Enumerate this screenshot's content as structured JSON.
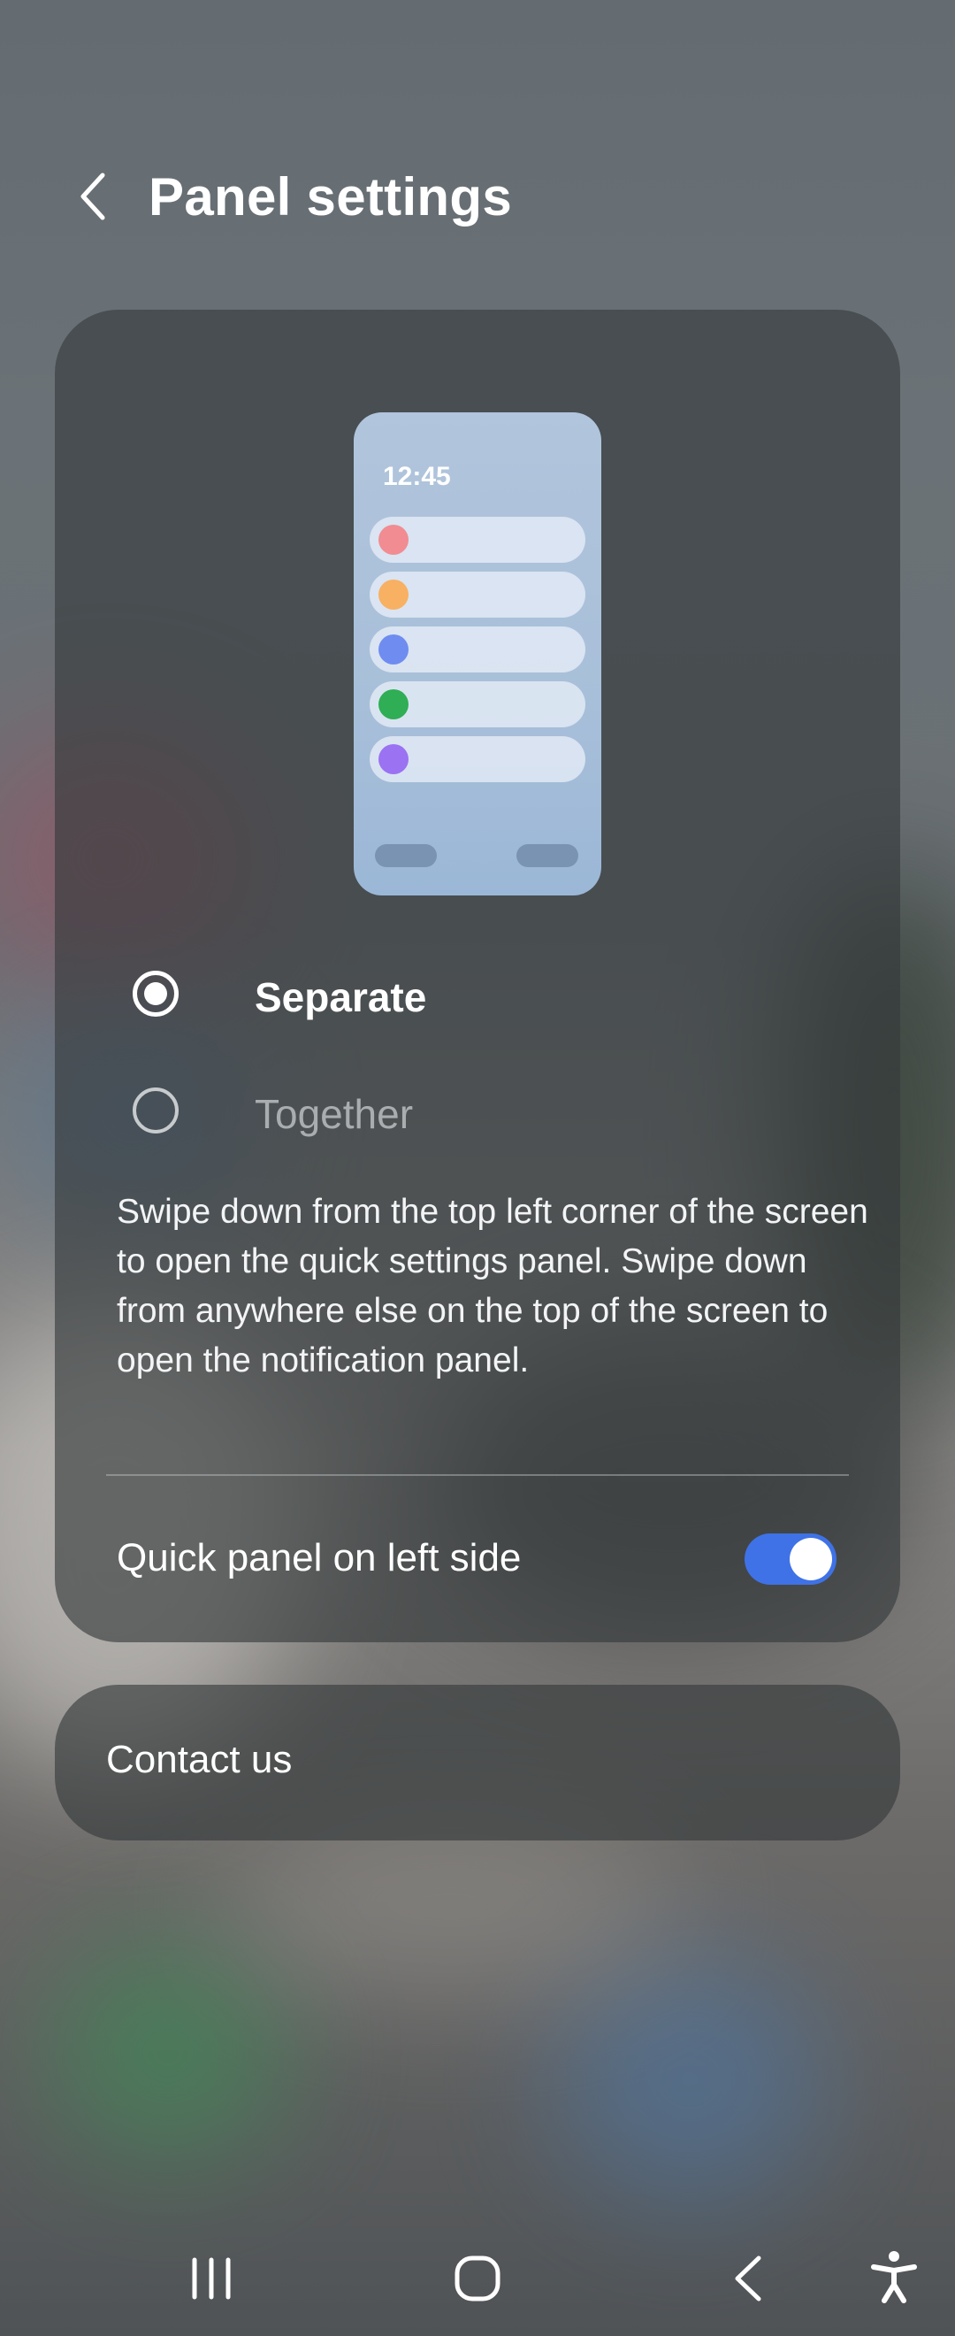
{
  "header": {
    "title": "Panel settings",
    "back_icon": "chevron-left-icon"
  },
  "preview": {
    "time": "12:45",
    "notification_dot_colors": [
      "#f08c92",
      "#f8b062",
      "#6f8cf0",
      "#2fae55",
      "#9a72f2"
    ]
  },
  "options": [
    {
      "label": "Separate",
      "selected": true
    },
    {
      "label": "Together",
      "selected": false
    }
  ],
  "description": "Swipe down from the top left corner of the screen to open the quick settings panel. Swipe down from anywhere else on the top of the screen to open the notification panel.",
  "toggle": {
    "label": "Quick panel on left side",
    "on": true,
    "accent_color": "#3f72e6"
  },
  "contact": {
    "label": "Contact us"
  },
  "navbar": {
    "icons": [
      "recent-apps-icon",
      "home-icon",
      "back-icon",
      "accessibility-icon"
    ]
  }
}
